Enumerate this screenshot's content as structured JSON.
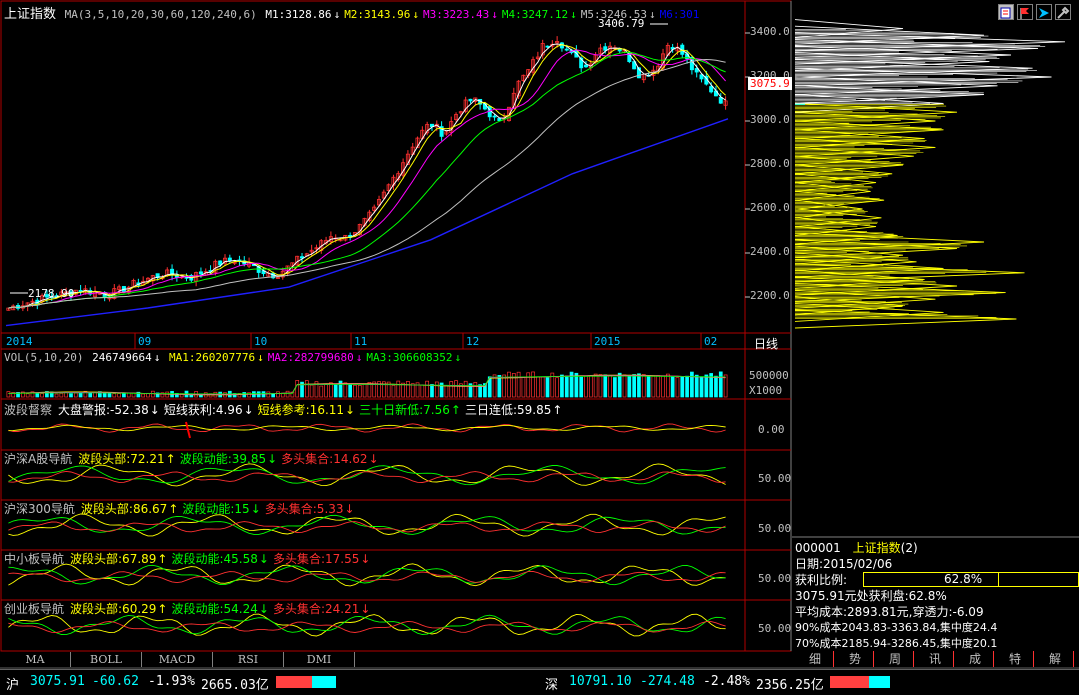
{
  "header": {
    "title": "上证指数",
    "ma_spec": "MA(3,5,10,20,30,60,120,240,6)",
    "ma_values": [
      {
        "label": "M1:3128.86",
        "arrow": "↓",
        "color": "#ffffff"
      },
      {
        "label": "M2:3143.96",
        "arrow": "↓",
        "color": "#ffff00"
      },
      {
        "label": "M3:3223.43",
        "arrow": "↓",
        "color": "#ff00ff"
      },
      {
        "label": "M4:3247.12",
        "arrow": "↓",
        "color": "#00ff00"
      },
      {
        "label": "M5:3246.53",
        "arrow": "↓",
        "color": "#c0c0c0"
      },
      {
        "label": "M6:301",
        "arrow": "",
        "color": "#0000ff"
      }
    ]
  },
  "price_axis": {
    "ticks": [
      "3400.0",
      "3200.0",
      "3000.0",
      "2800.0",
      "2600.0",
      "2400.0",
      "2200.0"
    ],
    "current": "3075.9"
  },
  "annotations": {
    "high": "3406.79",
    "low": "2178.90"
  },
  "time_axis": {
    "labels": [
      "2014",
      "09",
      "10",
      "11",
      "12",
      "2015",
      "02"
    ],
    "period": "日线"
  },
  "vol": {
    "spec": "VOL(5,10,20)",
    "value": "246749664",
    "items": [
      {
        "label": "MA1:260207776",
        "arrow": "↓",
        "color": "#ffff00"
      },
      {
        "label": "MA2:282799680",
        "arrow": "↓",
        "color": "#ff00ff"
      },
      {
        "label": "MA3:306608352",
        "arrow": "↓",
        "color": "#00ff00"
      }
    ],
    "axis": "500000",
    "unit": "X1000"
  },
  "panels": [
    {
      "title": "波段督察",
      "items": [
        {
          "label": "大盘警报:-52.38",
          "arrow": "↓",
          "color": "#ffffff"
        },
        {
          "label": "短线获利:4.96",
          "arrow": "↓",
          "color": "#ffffff"
        },
        {
          "label": "短线参考:16.11",
          "arrow": "↓",
          "color": "#ffff00"
        },
        {
          "label": "三十日新低:7.56",
          "arrow": "↑",
          "color": "#00ff00"
        },
        {
          "label": "三日连低:59.85",
          "arrow": "↑",
          "color": "#ffffff"
        }
      ],
      "axis": "0.00"
    },
    {
      "title": "沪深A股导航",
      "items": [
        {
          "label": "波段头部:72.21",
          "arrow": "↑",
          "color": "#ffff00"
        },
        {
          "label": "波段动能:39.85",
          "arrow": "↓",
          "color": "#00ff00"
        },
        {
          "label": "多头集合:14.62",
          "arrow": "↓",
          "color": "#ff3030"
        }
      ],
      "axis": "50.00"
    },
    {
      "title": "沪深300导航",
      "items": [
        {
          "label": "波段头部:86.67",
          "arrow": "↑",
          "color": "#ffff00"
        },
        {
          "label": "波段动能:15",
          "arrow": "↓",
          "color": "#00ff00"
        },
        {
          "label": "多头集合:5.33",
          "arrow": "↓",
          "color": "#ff3030"
        }
      ],
      "axis": "50.00"
    },
    {
      "title": "中小板导航",
      "items": [
        {
          "label": "波段头部:67.89",
          "arrow": "↑",
          "color": "#ffff00"
        },
        {
          "label": "波段动能:45.58",
          "arrow": "↓",
          "color": "#00ff00"
        },
        {
          "label": "多头集合:17.55",
          "arrow": "↓",
          "color": "#ff3030"
        }
      ],
      "axis": "50.00"
    },
    {
      "title": "创业板导航",
      "items": [
        {
          "label": "波段头部:60.29",
          "arrow": "↑",
          "color": "#ffff00"
        },
        {
          "label": "波段动能:54.24",
          "arrow": "↓",
          "color": "#00ff00"
        },
        {
          "label": "多头集合:24.21",
          "arrow": "↓",
          "color": "#ff3030"
        }
      ],
      "axis": "50.00"
    }
  ],
  "bottom_tabs": [
    "MA",
    "BOLL",
    "MACD",
    "RSI",
    "DMI"
  ],
  "info": {
    "code_line": "000001",
    "name": "上证指数",
    "count": "(2)",
    "date": "日期:2015/02/06",
    "ratio_label": "获利比例:",
    "ratio_value": "62.8%",
    "ratio_fraction": 0.628,
    "line1": "3075.91元处获利盘:62.8%",
    "line2": "平均成本:2893.81元,穿透力:-6.09",
    "line3": "90%成本2043.83-3363.84,集中度24.4",
    "line4": "70%成本2185.94-3286.45,集中度20.1"
  },
  "right_tabs": [
    "细",
    "势",
    "周",
    "讯",
    "成",
    "特",
    "解"
  ],
  "status": {
    "sh_label": "沪",
    "sh_price": "3075.91",
    "sh_change": "-60.62",
    "sh_pct": "-1.93%",
    "sh_amount": "2665.03亿",
    "sz_label": "深",
    "sz_price": "10791.10",
    "sz_change": "-274.48",
    "sz_pct": "-2.48%",
    "sz_amount": "2356.25亿"
  },
  "chart_data": {
    "type": "candlestick",
    "ylim": [
      2050,
      3450
    ],
    "yticks": [
      2200,
      2400,
      2600,
      2800,
      3000,
      3200,
      3400
    ],
    "close_path": [
      [
        0,
        2150
      ],
      [
        10,
        2170
      ],
      [
        20,
        2185
      ],
      [
        30,
        2200
      ],
      [
        40,
        2215
      ],
      [
        50,
        2235
      ],
      [
        60,
        2225
      ],
      [
        70,
        2210
      ],
      [
        80,
        2230
      ],
      [
        90,
        2260
      ],
      [
        100,
        2285
      ],
      [
        110,
        2305
      ],
      [
        120,
        2300
      ],
      [
        130,
        2290
      ],
      [
        140,
        2320
      ],
      [
        150,
        2355
      ],
      [
        160,
        2370
      ],
      [
        170,
        2350
      ],
      [
        180,
        2320
      ],
      [
        190,
        2300
      ],
      [
        200,
        2340
      ],
      [
        210,
        2390
      ],
      [
        220,
        2430
      ],
      [
        230,
        2480
      ],
      [
        240,
        2470
      ],
      [
        250,
        2520
      ],
      [
        260,
        2590
      ],
      [
        270,
        2700
      ],
      [
        280,
        2810
      ],
      [
        290,
        2920
      ],
      [
        300,
        2990
      ],
      [
        310,
        2940
      ],
      [
        320,
        3050
      ],
      [
        330,
        3100
      ],
      [
        340,
        3050
      ],
      [
        350,
        2980
      ],
      [
        360,
        3150
      ],
      [
        370,
        3230
      ],
      [
        380,
        3340
      ],
      [
        390,
        3380
      ],
      [
        400,
        3300
      ],
      [
        410,
        3240
      ],
      [
        420,
        3330
      ],
      [
        430,
        3350
      ],
      [
        440,
        3300
      ],
      [
        450,
        3200
      ],
      [
        460,
        3240
      ],
      [
        470,
        3360
      ],
      [
        480,
        3300
      ],
      [
        490,
        3200
      ],
      [
        500,
        3140
      ],
      [
        510,
        3076
      ]
    ],
    "ma240_path": [
      [
        0,
        2070
      ],
      [
        100,
        2150
      ],
      [
        200,
        2245
      ],
      [
        300,
        2460
      ],
      [
        400,
        2760
      ],
      [
        510,
        3010
      ]
    ],
    "chip_profile": [
      [
        2100,
        0.82
      ],
      [
        2130,
        0.55
      ],
      [
        2160,
        0.4
      ],
      [
        2190,
        0.52
      ],
      [
        2220,
        0.78
      ],
      [
        2250,
        0.6
      ],
      [
        2280,
        0.48
      ],
      [
        2310,
        0.85
      ],
      [
        2330,
        0.55
      ],
      [
        2360,
        0.45
      ],
      [
        2390,
        0.4
      ],
      [
        2420,
        0.6
      ],
      [
        2450,
        0.7
      ],
      [
        2480,
        0.38
      ],
      [
        2520,
        0.3
      ],
      [
        2560,
        0.32
      ],
      [
        2600,
        0.25
      ],
      [
        2640,
        0.33
      ],
      [
        2680,
        0.28
      ],
      [
        2720,
        0.3
      ],
      [
        2760,
        0.36
      ],
      [
        2800,
        0.4
      ],
      [
        2840,
        0.44
      ],
      [
        2880,
        0.52
      ],
      [
        2920,
        0.48
      ],
      [
        2960,
        0.55
      ],
      [
        3000,
        0.52
      ],
      [
        3040,
        0.6
      ],
      [
        3080,
        0.55
      ],
      [
        3120,
        0.7
      ],
      [
        3160,
        0.75
      ],
      [
        3200,
        0.95
      ],
      [
        3240,
        0.88
      ],
      [
        3270,
        0.72
      ],
      [
        3300,
        0.8
      ],
      [
        3330,
        0.9
      ],
      [
        3360,
        1.0
      ],
      [
        3390,
        0.7
      ],
      [
        3420,
        0.4
      ]
    ]
  }
}
